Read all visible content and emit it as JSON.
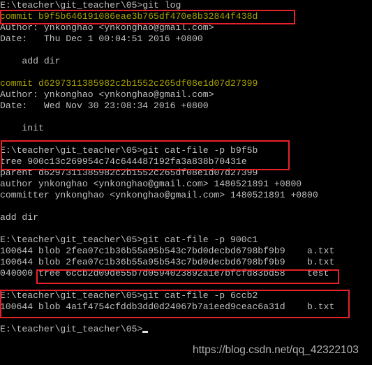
{
  "colors": {
    "text": "#c0c0c0",
    "commit": "#a8a000",
    "highlight_box": "#e8202a",
    "background": "#000000"
  },
  "lines": [
    "E:\\teacher\\git_teacher\\05>git log",
    "commit b9f5b646191086eae3b765df470e8b32844f438d",
    "Author: ynkonghao <ynkonghao@gmail.com>",
    "Date:   Thu Dec 1 00:04:51 2016 +0800",
    "",
    "    add dir",
    "",
    "commit d6297311385982c2b1552c265df08e1d07d27399",
    "Author: ynkonghao <ynkonghao@gmail.com>",
    "Date:   Wed Nov 30 23:08:34 2016 +0800",
    "",
    "    init",
    "",
    "E:\\teacher\\git_teacher\\05>git cat-file -p b9f5b",
    "tree 900c13c269954c74c644487192fa3a838b70431e",
    "parent d6297311385982c2b1552c265df08e1d07d27399",
    "author ynkonghao <ynkonghao@gmail.com> 1480521891 +0800",
    "committer ynkonghao <ynkonghao@gmail.com> 1480521891 +0800",
    "",
    "add dir",
    "",
    "E:\\teacher\\git_teacher\\05>git cat-file -p 900c1",
    "100644 blob 2fea07c1b36b55a95b543c7bd0decbd6798bf9b9    a.txt",
    "100644 blob 2fea07c1b36b55a95b543c7bd0decbd6798bf9b9    b.txt",
    "040000 tree 6ccb2d09de55b7d0594023892a1e7bfcfd83bd58    test",
    "",
    "E:\\teacher\\git_teacher\\05>git cat-file -p 6ccb2",
    "100644 blob 4a1f4754cfddb3dd0d24067b7a1eed9ceac6a31d    b.txt",
    "",
    "E:\\teacher\\git_teacher\\05>"
  ],
  "commit_line_indices": [
    1,
    7
  ],
  "watermark": "https://blog.csdn.net/qq_42322103"
}
